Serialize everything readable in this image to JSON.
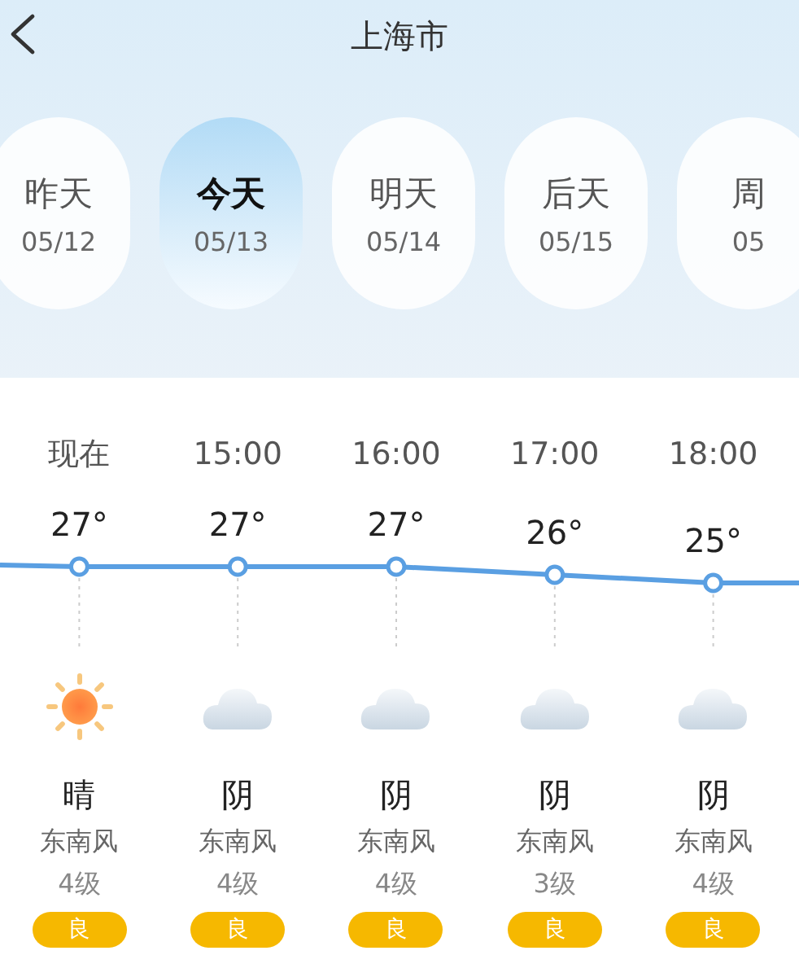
{
  "header": {
    "title": "上海市"
  },
  "days": [
    {
      "label": "昨天",
      "date": "05/12",
      "selected": false
    },
    {
      "label": "今天",
      "date": "05/13",
      "selected": true
    },
    {
      "label": "明天",
      "date": "05/14",
      "selected": false
    },
    {
      "label": "后天",
      "date": "05/15",
      "selected": false
    },
    {
      "label": "周",
      "date": "05",
      "selected": false
    }
  ],
  "hours": [
    {
      "time": "现在",
      "temp": "27°",
      "kind": "sunny",
      "weather": "晴",
      "wind": "东南风",
      "wind_level": "4级",
      "aqi": "良"
    },
    {
      "time": "15:00",
      "temp": "27°",
      "kind": "cloudy",
      "weather": "阴",
      "wind": "东南风",
      "wind_level": "4级",
      "aqi": "良"
    },
    {
      "time": "16:00",
      "temp": "27°",
      "kind": "cloudy",
      "weather": "阴",
      "wind": "东南风",
      "wind_level": "4级",
      "aqi": "良"
    },
    {
      "time": "17:00",
      "temp": "26°",
      "kind": "cloudy",
      "weather": "阴",
      "wind": "东南风",
      "wind_level": "3级",
      "aqi": "良"
    },
    {
      "time": "18:00",
      "temp": "25°",
      "kind": "cloudy",
      "weather": "阴",
      "wind": "东南风",
      "wind_level": "4级",
      "aqi": "良"
    }
  ]
}
